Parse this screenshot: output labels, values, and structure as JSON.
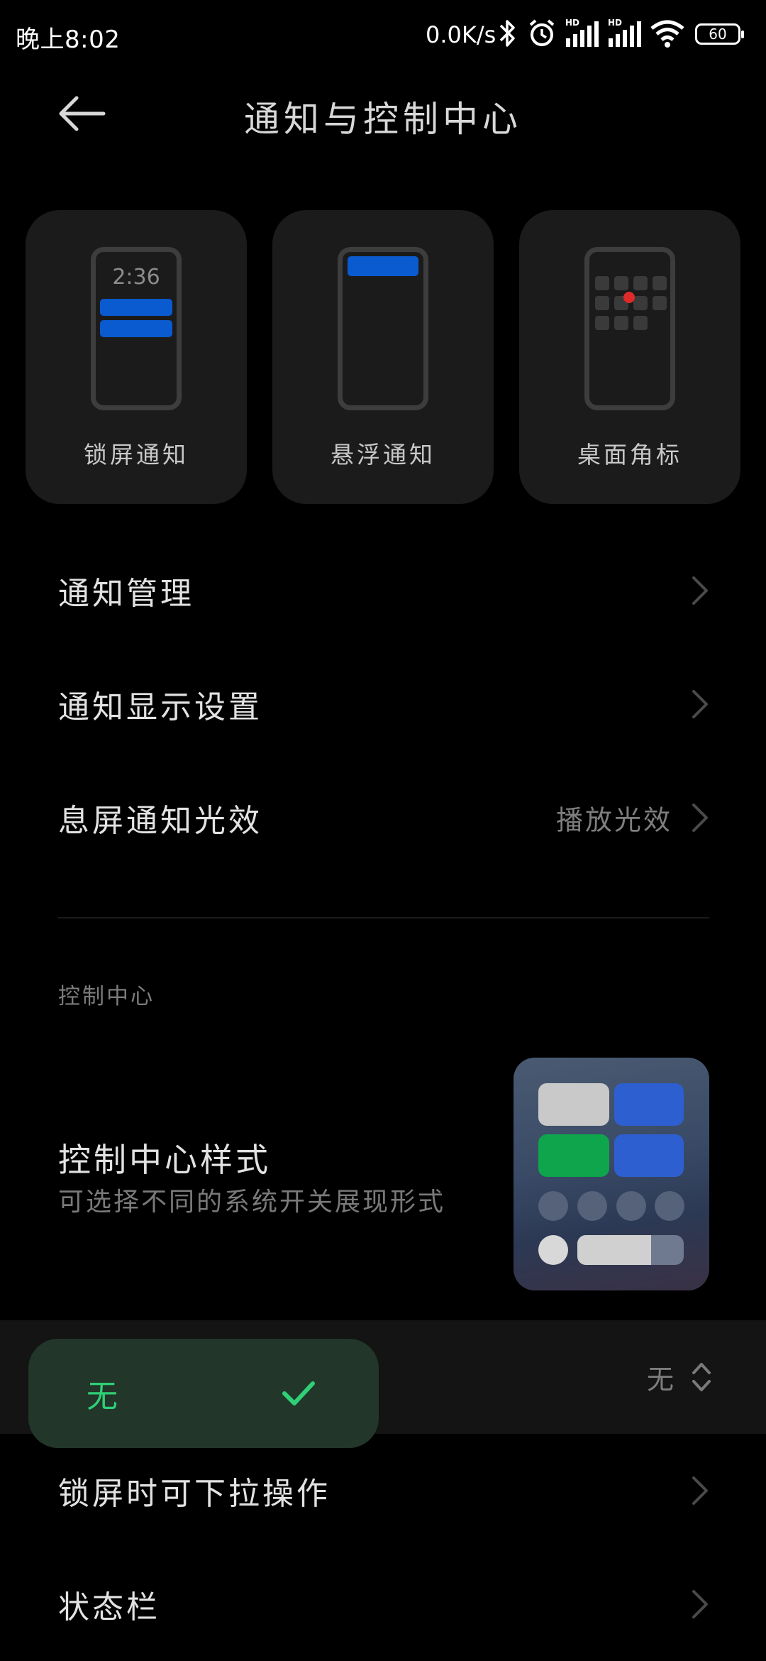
{
  "status_bar": {
    "time": "晚上8:02",
    "speed": "0.0K/s",
    "battery": "60",
    "icons": [
      "bluetooth-icon",
      "alarm-icon",
      "signal-hd-icon",
      "signal-hd-icon",
      "wifi-icon",
      "battery-icon"
    ]
  },
  "header": {
    "title": "通知与控制中心",
    "back_icon": "back-arrow-icon"
  },
  "cards": [
    {
      "label": "锁屏通知",
      "preview_time": "2:36"
    },
    {
      "label": "悬浮通知"
    },
    {
      "label": "桌面角标"
    }
  ],
  "rows": {
    "notification_manage": "通知管理",
    "notification_display": "通知显示设置",
    "screen_off_light": {
      "label": "息屏通知光效",
      "value": "播放光效"
    }
  },
  "section": {
    "control_center_header": "控制中心"
  },
  "control_center_style": {
    "title": "控制中心样式",
    "subtitle": "可选择不同的系统开关展现形式"
  },
  "dropdown": {
    "current_value": "无",
    "popup_option": "无",
    "popup_selected": true
  },
  "rows2": {
    "lockscreen_pulldown": "锁屏时可下拉操作",
    "status_bar": "状态栏"
  },
  "colors": {
    "accent_green": "#2fcf76",
    "blue": "#0a5ad0",
    "background": "#000000",
    "card": "#1b1b1b"
  }
}
